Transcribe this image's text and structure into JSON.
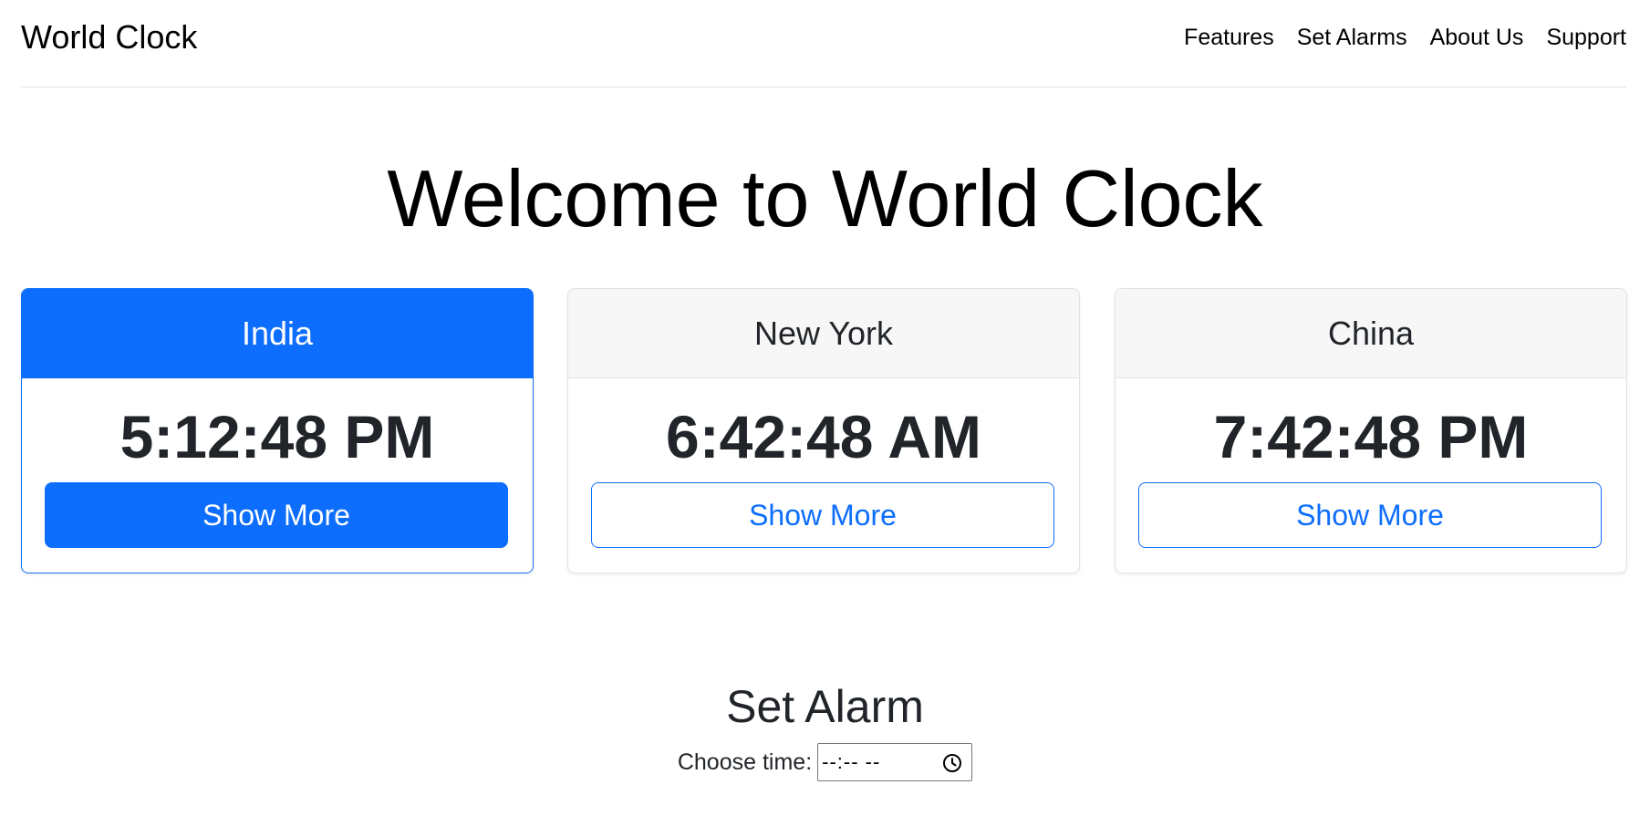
{
  "header": {
    "brand": "World Clock",
    "nav": [
      "Features",
      "Set Alarms",
      "About Us",
      "Support"
    ]
  },
  "main": {
    "title": "Welcome to World Clock"
  },
  "cards": [
    {
      "city": "India",
      "time": "5:12:48 PM",
      "button": "Show More",
      "active": true
    },
    {
      "city": "New York",
      "time": "6:42:48 AM",
      "button": "Show More",
      "active": false
    },
    {
      "city": "China",
      "time": "7:42:48 PM",
      "button": "Show More",
      "active": false
    }
  ],
  "alarm": {
    "title": "Set Alarm",
    "label": "Choose time:",
    "value_placeholder": "--:-- --",
    "icon": "clock-icon"
  },
  "colors": {
    "primary": "#0d6efd",
    "card_header_bg": "#f7f7f7",
    "text": "#212529",
    "border": "#dee2e6"
  }
}
